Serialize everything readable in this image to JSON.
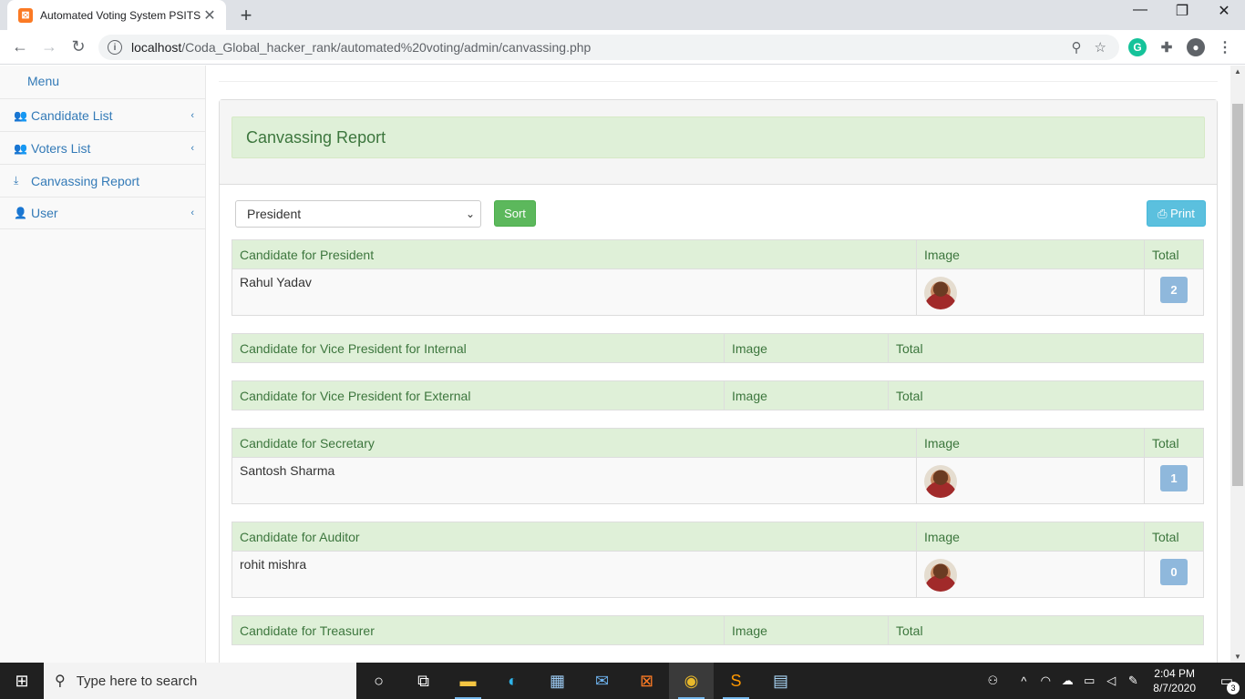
{
  "browser": {
    "tab_title": "Automated Voting System PSITS",
    "url_host": "localhost",
    "url_path": "/Coda_Global_hacker_rank/automated%20voting/admin/canvassing.php"
  },
  "sidebar": {
    "menu_label": "Menu",
    "items": [
      {
        "label": "Candidate List",
        "icon": "users-icon",
        "has_arrow": true
      },
      {
        "label": "Voters List",
        "icon": "users-icon",
        "has_arrow": true
      },
      {
        "label": "Canvassing Report",
        "icon": "download-icon",
        "has_arrow": false
      },
      {
        "label": "User",
        "icon": "user-icon",
        "has_arrow": true
      }
    ]
  },
  "main": {
    "report_title": "Canvassing Report",
    "position_select": "President",
    "sort_label": "Sort",
    "print_label": "Print",
    "tables": [
      {
        "header": "Candidate for President",
        "image_label": "Image",
        "total_label": "Total",
        "rows": [
          {
            "name": "Rahul Yadav",
            "total": "2"
          }
        ]
      },
      {
        "header": "Candidate for Vice President for Internal",
        "image_label": "Image",
        "total_label": "Total",
        "rows": []
      },
      {
        "header": "Candidate for Vice President for External",
        "image_label": "Image",
        "total_label": "Total",
        "rows": []
      },
      {
        "header": "Candidate for Secretary",
        "image_label": "Image",
        "total_label": "Total",
        "rows": [
          {
            "name": "Santosh Sharma",
            "total": "1"
          }
        ]
      },
      {
        "header": "Candidate for Auditor",
        "image_label": "Image",
        "total_label": "Total",
        "rows": [
          {
            "name": "rohit mishra",
            "total": "0"
          }
        ]
      },
      {
        "header": "Candidate for Treasurer",
        "image_label": "Image",
        "total_label": "Total",
        "rows": []
      }
    ]
  },
  "taskbar": {
    "search_placeholder": "Type here to search",
    "time": "2:04 PM",
    "date": "8/7/2020",
    "notification_count": "3"
  },
  "colors": {
    "accent": "#337ab7",
    "success_bg": "#dff0d8",
    "success_text": "#3c763d",
    "sort_button": "#5cb85c",
    "print_button": "#5bc0de",
    "badge": "#8fb8dc"
  }
}
